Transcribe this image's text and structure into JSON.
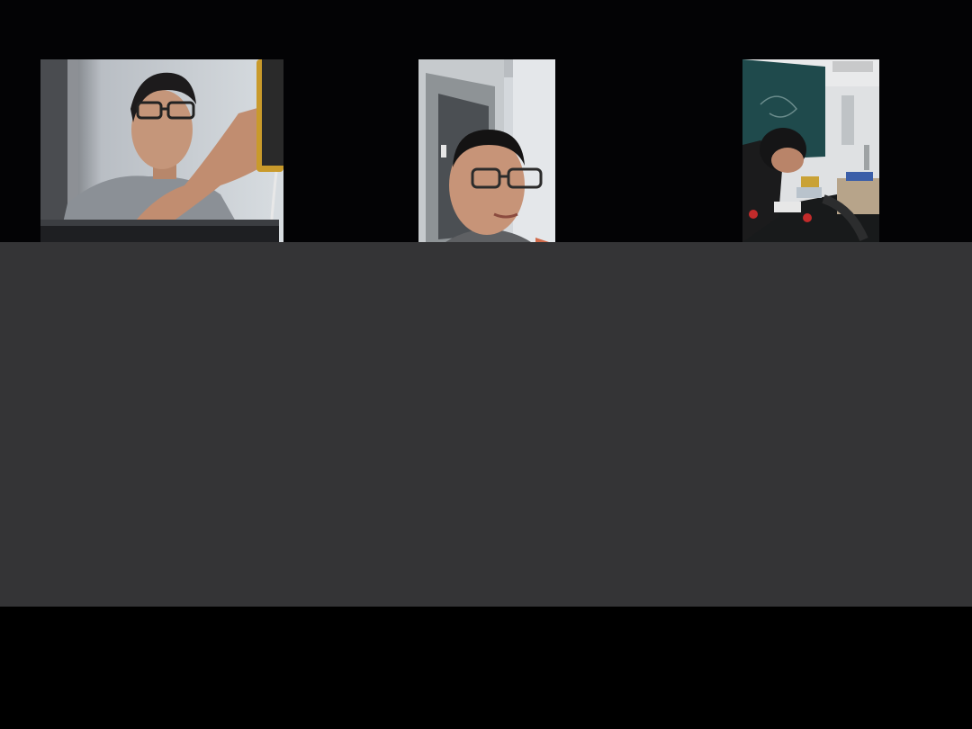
{
  "participants": [
    {
      "id": "participant-1",
      "scene": "person-with-glasses-at-keyboard-holding-phone"
    },
    {
      "id": "participant-2",
      "scene": "close-up-face-with-glasses-doorway-background"
    },
    {
      "id": "participant-3",
      "scene": "person-at-workbench-chalkboard-background"
    }
  ],
  "colors": {
    "strip_bg": "#030305",
    "stage_bg": "#343436",
    "bottom_bg": "#000000"
  }
}
